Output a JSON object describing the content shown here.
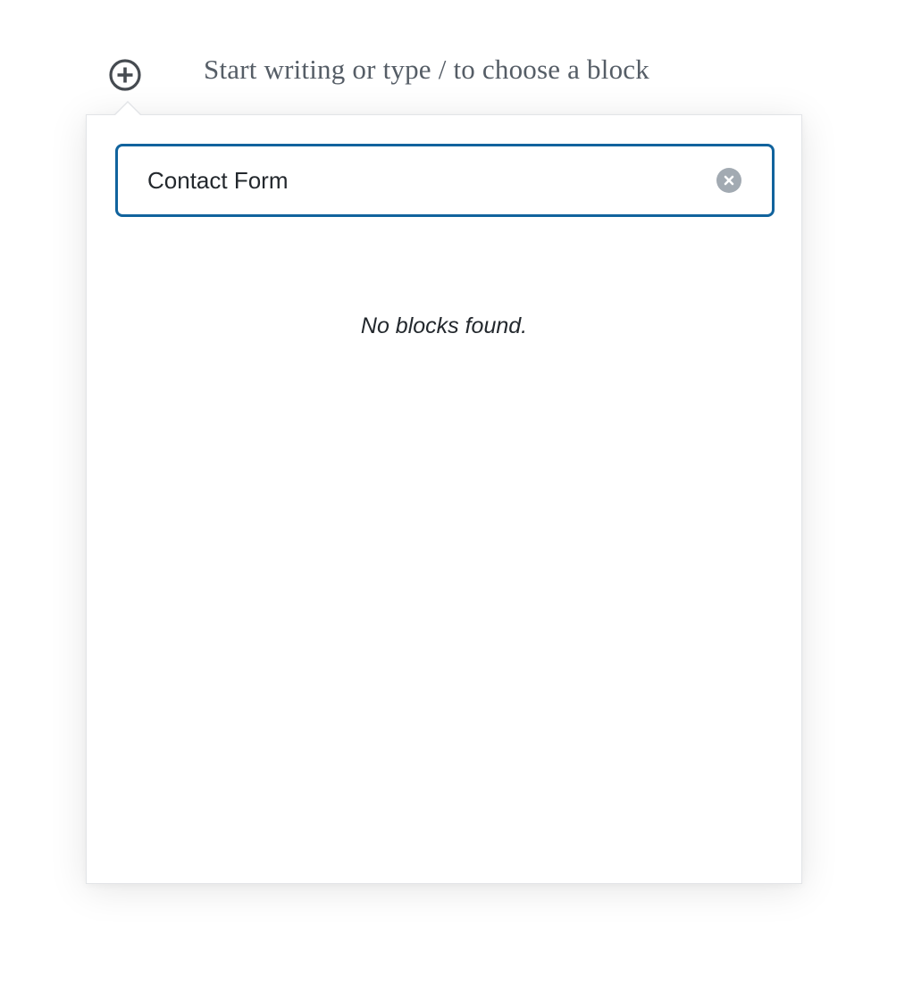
{
  "editor": {
    "placeholder": "Start writing or type / to choose a block",
    "inserter_icon": "plus-circle-icon"
  },
  "inserter": {
    "search": {
      "value": "Contact Form",
      "clear_icon": "clear-circle-icon"
    },
    "no_results": "No blocks found."
  },
  "colors": {
    "accent": "#11639d",
    "text": "#23282d",
    "muted": "#555d66",
    "clear_bg": "#a2aab2",
    "border": "#e2e4e7"
  }
}
